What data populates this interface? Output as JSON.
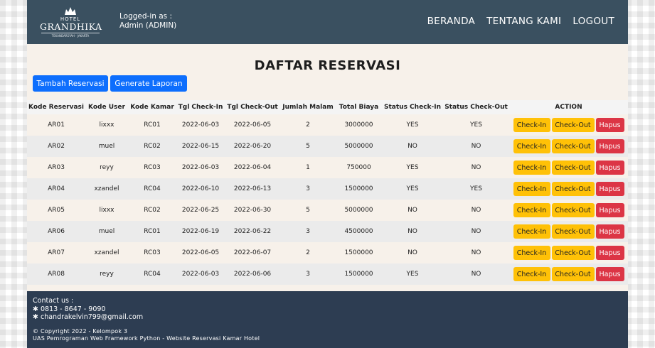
{
  "header": {
    "logo": {
      "top": "HOTEL",
      "brand": "GRANDHIKA",
      "sub": "TEKANDARSYAH · JAKARTA"
    },
    "login_label": "Logged-in as :",
    "login_user": "Admin (ADMIN)",
    "nav": [
      "BERANDA",
      "TENTANG KAMI",
      "LOGOUT"
    ]
  },
  "main": {
    "title": "DAFTAR RESERVASI",
    "add_button": "Tambah Reservasi",
    "report_button": "Generate Laporan",
    "columns": [
      "Kode Reservasi",
      "Kode User",
      "Kode Kamar",
      "Tgl Check-In",
      "Tgl Check-Out",
      "Jumlah Malam",
      "Total Biaya",
      "Status Check-In",
      "Status Check-Out",
      "ACTION"
    ],
    "action_labels": {
      "checkin": "Check-In",
      "checkout": "Check-Out",
      "delete": "Hapus"
    },
    "rows": [
      [
        "AR01",
        "lixxx",
        "RC01",
        "2022-06-03",
        "2022-06-05",
        "2",
        "3000000",
        "YES",
        "YES"
      ],
      [
        "AR02",
        "muel",
        "RC02",
        "2022-06-15",
        "2022-06-20",
        "5",
        "5000000",
        "NO",
        "NO"
      ],
      [
        "AR03",
        "reyy",
        "RC03",
        "2022-06-03",
        "2022-06-04",
        "1",
        "750000",
        "YES",
        "NO"
      ],
      [
        "AR04",
        "xzandel",
        "RC04",
        "2022-06-10",
        "2022-06-13",
        "3",
        "1500000",
        "YES",
        "YES"
      ],
      [
        "AR05",
        "lixxx",
        "RC02",
        "2022-06-25",
        "2022-06-30",
        "5",
        "5000000",
        "NO",
        "NO"
      ],
      [
        "AR06",
        "muel",
        "RC01",
        "2022-06-19",
        "2022-06-22",
        "3",
        "4500000",
        "NO",
        "NO"
      ],
      [
        "AR07",
        "xzandel",
        "RC03",
        "2022-06-05",
        "2022-06-07",
        "2",
        "1500000",
        "NO",
        "NO"
      ],
      [
        "AR08",
        "reyy",
        "RC04",
        "2022-06-03",
        "2022-06-06",
        "3",
        "1500000",
        "YES",
        "NO"
      ]
    ]
  },
  "footer": {
    "contact_label": "Contact us :",
    "phone": "✱ 0813 - 8647 - 9090",
    "email": "✱ chandrakelvin799@gmail.com",
    "copyright": "© Copyright 2022 - Kelompok 3",
    "course": "UAS Pemrograman Web Framework Python - Website Reservasi Kamar Hotel"
  },
  "colors": {
    "navbar": "#3a5060",
    "footer": "#2d3d52",
    "primary": "#0d6efd",
    "warning": "#ffc107",
    "danger": "#dc3545"
  }
}
